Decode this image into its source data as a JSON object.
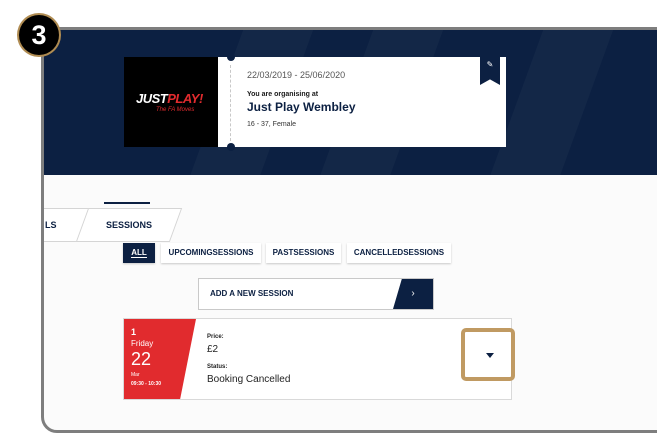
{
  "step_badge": "3",
  "event": {
    "logo_text_part1": "JUST",
    "logo_text_part2": "PLAY",
    "logo_text_part3": "!",
    "logo_subtext": "The FA Moves",
    "dates": "22/03/2019 - 25/06/2020",
    "organising_label": "You are organising at",
    "name": "Just Play Wembley",
    "meta": "16 - 37, Female",
    "corner_icon": "edit-icon"
  },
  "tabs": {
    "partial_label": "LS",
    "sessions_label": "SESSIONS"
  },
  "filters": [
    {
      "label": "ALL",
      "active": true
    },
    {
      "label": "UPCOMINGSESSIONS",
      "active": false
    },
    {
      "label": "PASTSESSIONS",
      "active": false
    },
    {
      "label": "CANCELLEDSESSIONS",
      "active": false
    }
  ],
  "add_session": {
    "label": "ADD A NEW SESSION",
    "arrow": "›"
  },
  "session": {
    "number": "1",
    "weekday": "Friday",
    "day": "22",
    "month": "Mar",
    "time": "09:30 - 10:30",
    "price_label": "Price:",
    "price": "£2",
    "status_label": "Status:",
    "status": "Booking Cancelled",
    "expand_icon": "chevron-down-icon"
  },
  "colors": {
    "navy": "#0c2042",
    "red": "#e12b2e",
    "highlight": "#c09a62"
  }
}
